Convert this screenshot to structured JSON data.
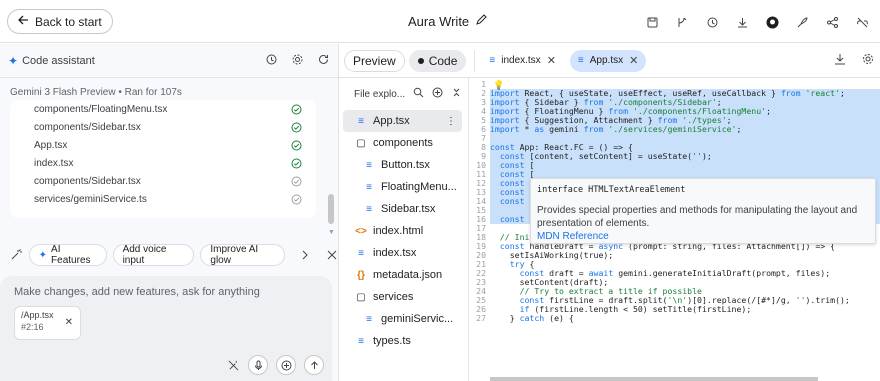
{
  "topbar": {
    "back_label": "Back to start",
    "title": "Aura Write",
    "icons": [
      "save-icon",
      "branch-icon",
      "history-icon",
      "download-icon",
      "github-icon",
      "deploy-icon",
      "share-icon",
      "link-off-icon"
    ]
  },
  "assistant": {
    "title": "Code assistant",
    "model_line": "Gemini 3 Flash Preview  •  Ran for 107s",
    "files": [
      "components/FloatingMenu.tsx",
      "components/Sidebar.tsx",
      "App.tsx",
      "index.tsx",
      "components/Sidebar.tsx",
      "services/geminiService.ts"
    ],
    "suggestions": [
      "AI Features",
      "Add voice input",
      "Improve AI glow"
    ],
    "prompt_placeholder": "Make changes, add new features, ask for anything",
    "attachment": {
      "name": "/App.tsx",
      "range": "#2:16"
    }
  },
  "editor": {
    "preview_label": "Preview",
    "code_label": "Code",
    "tabs": [
      {
        "label": "index.tsx",
        "active": false
      },
      {
        "label": "App.tsx",
        "active": true
      }
    ]
  },
  "explorer": {
    "title": "File explo...",
    "items": [
      {
        "label": "App.tsx",
        "type": "ts",
        "indent": false,
        "active": true
      },
      {
        "label": "components",
        "type": "folder",
        "indent": false,
        "active": false
      },
      {
        "label": "Button.tsx",
        "type": "ts",
        "indent": true,
        "active": false
      },
      {
        "label": "FloatingMenu...",
        "type": "ts",
        "indent": true,
        "active": false
      },
      {
        "label": "Sidebar.tsx",
        "type": "ts",
        "indent": true,
        "active": false
      },
      {
        "label": "index.html",
        "type": "html",
        "indent": false,
        "active": false
      },
      {
        "label": "index.tsx",
        "type": "ts",
        "indent": false,
        "active": false
      },
      {
        "label": "metadata.json",
        "type": "json",
        "indent": false,
        "active": false
      },
      {
        "label": "services",
        "type": "folder",
        "indent": false,
        "active": false
      },
      {
        "label": "geminiServic...",
        "type": "ts",
        "indent": true,
        "active": false
      },
      {
        "label": "types.ts",
        "type": "ts",
        "indent": false,
        "active": false
      }
    ]
  },
  "tooltip": {
    "signature": "interface HTMLTextAreaElement",
    "description": "Provides special properties and methods for manipulating the layout and presentation of elements.",
    "link": "MDN Reference"
  },
  "code_lines": [
    {
      "n": "1",
      "t": ""
    },
    {
      "n": "2",
      "t": "import React, { useState, useEffect, useRef, useCallback } from 'react';"
    },
    {
      "n": "3",
      "t": "import { Sidebar } from './components/Sidebar';"
    },
    {
      "n": "4",
      "t": "import { FloatingMenu } from './components/FloatingMenu';"
    },
    {
      "n": "5",
      "t": "import { Suggestion, Attachment } from './types';"
    },
    {
      "n": "6",
      "t": "import * as gemini from './services/geminiService';"
    },
    {
      "n": "7",
      "t": ""
    },
    {
      "n": "8",
      "t": "const App: React.FC = () => {"
    },
    {
      "n": "9",
      "t": "  const [content, setContent] = useState('');"
    },
    {
      "n": "10",
      "t": "  const ["
    },
    {
      "n": "11",
      "t": "  const ["
    },
    {
      "n": "12",
      "t": "  const ["
    },
    {
      "n": "13",
      "t": "  const ["
    },
    {
      "n": "14",
      "t": "  const ["
    },
    {
      "n": "15",
      "t": ""
    },
    {
      "n": "16",
      "t": "  const contentRef = useRef<HTMLTextAreaElement>(null);"
    },
    {
      "n": "17",
      "t": ""
    },
    {
      "n": "18",
      "t": "  // Initial drafting"
    },
    {
      "n": "19",
      "t": "  const handleDraft = async (prompt: string, files: Attachment[]) => {"
    },
    {
      "n": "20",
      "t": "    setIsAiWorking(true);"
    },
    {
      "n": "21",
      "t": "    try {"
    },
    {
      "n": "22",
      "t": "      const draft = await gemini.generateInitialDraft(prompt, files);"
    },
    {
      "n": "23",
      "t": "      setContent(draft);"
    },
    {
      "n": "24",
      "t": "      // Try to extract a title if possible"
    },
    {
      "n": "25",
      "t": "      const firstLine = draft.split('\\n')[0].replace(/[#*]/g, '').trim();"
    },
    {
      "n": "26",
      "t": "      if (firstLine.length < 50) setTitle(firstLine);"
    },
    {
      "n": "27",
      "t": "    } catch (e) {"
    }
  ]
}
